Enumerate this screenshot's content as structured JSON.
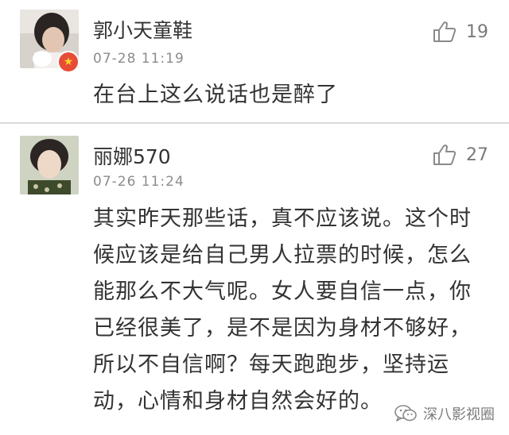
{
  "comments": [
    {
      "username": "郭小天童鞋",
      "timestamp": "07-28 11:19",
      "likes": "19",
      "text": "在台上这么说话也是醉了",
      "verified": true
    },
    {
      "username": "丽娜570",
      "timestamp": "07-26 11:24",
      "likes": "27",
      "text": "其实昨天那些话，真不应该说。这个时候应该是给自己男人拉票的时候，怎么能那么不大气呢。女人要自信一点，你已经很美了，是不是因为身材不够好，所以不自信啊？每天跑跑步，坚持运动，心情和身材自然会好的。",
      "verified": false
    }
  ],
  "watermark": {
    "label": "深八影视圈",
    "icon": "wechat-icon"
  },
  "icons": {
    "like": "thumbs-up-icon",
    "badge": "verified-star-icon"
  },
  "colors": {
    "text": "#333333",
    "meta": "#8c8c8c",
    "badge": "#e64c36",
    "divider": "#d9d9d9"
  }
}
